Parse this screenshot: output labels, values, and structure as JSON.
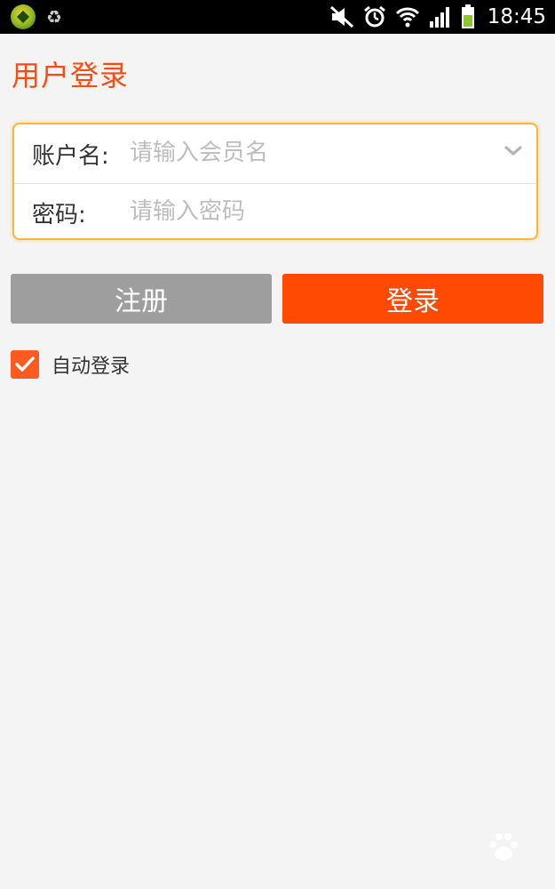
{
  "status_bar": {
    "time": "18:45",
    "icons": [
      "app-badge-icon",
      "recycle-icon",
      "mute-icon",
      "alarm-icon",
      "wifi-icon",
      "signal-icon",
      "battery-icon"
    ]
  },
  "page": {
    "title": "用户登录"
  },
  "form": {
    "account_label": "账户名:",
    "account_placeholder": "请输入会员名",
    "account_value": "",
    "password_label": "密码:",
    "password_placeholder": "请输入密码",
    "password_value": ""
  },
  "buttons": {
    "register_label": "注册",
    "login_label": "登录"
  },
  "auto_login": {
    "label": "自动登录",
    "checked": true
  },
  "colors": {
    "accent": "#ff4a14",
    "login_button": "#ff4a04",
    "register_button": "#9e9e9e",
    "card_border": "#f6b73c",
    "background": "#f4f4f4"
  }
}
